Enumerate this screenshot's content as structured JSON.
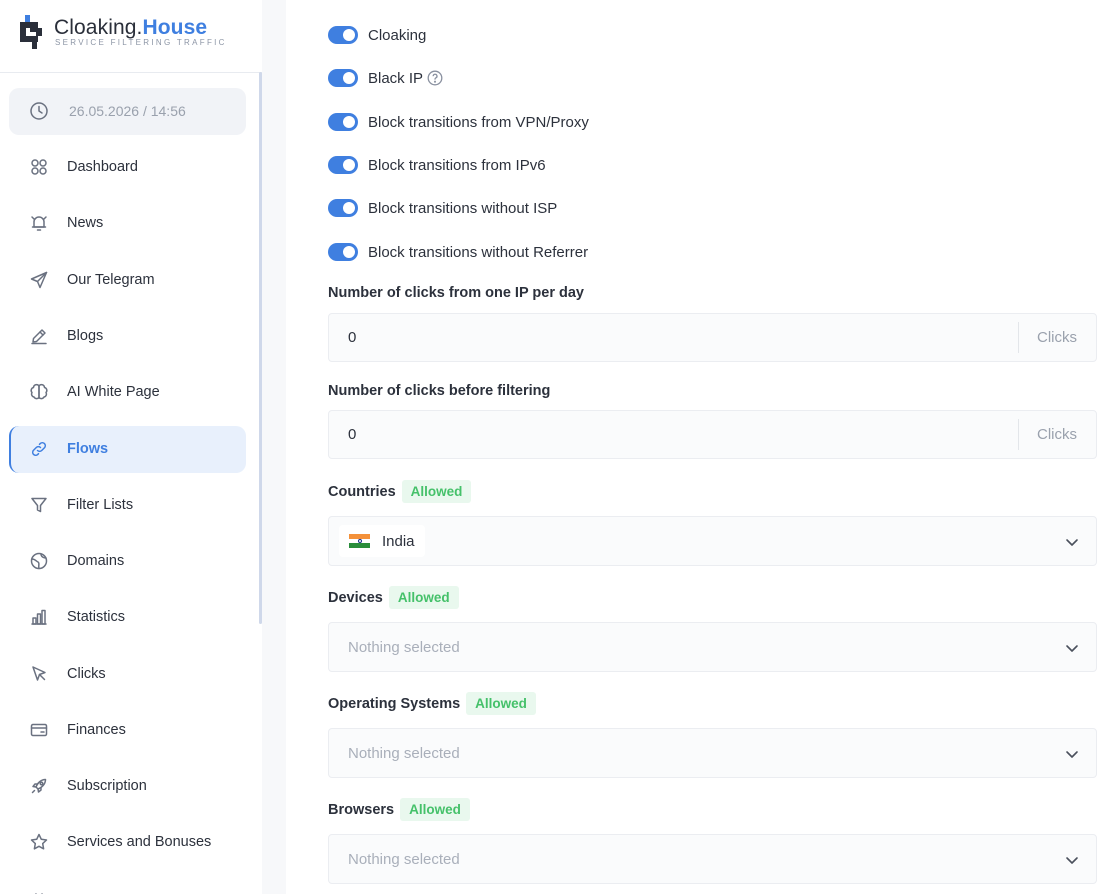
{
  "brand": {
    "name_part1": "Cloaking.",
    "name_part2": "House",
    "tagline": "SERVICE FILTERING TRAFFIC",
    "accent_color": "#3f7fe0"
  },
  "sidebar": {
    "datetime": "26.05.2026 / 14:56",
    "items": [
      {
        "label": "Dashboard",
        "icon": "dashboard-icon"
      },
      {
        "label": "News",
        "icon": "bell-icon"
      },
      {
        "label": "Our Telegram",
        "icon": "send-icon"
      },
      {
        "label": "Blogs",
        "icon": "pencil-icon"
      },
      {
        "label": "AI White Page",
        "icon": "brain-icon"
      },
      {
        "label": "Flows",
        "icon": "link-icon",
        "active": true
      },
      {
        "label": "Filter Lists",
        "icon": "filter-icon"
      },
      {
        "label": "Domains",
        "icon": "globe-icon"
      },
      {
        "label": "Statistics",
        "icon": "bar-chart-icon"
      },
      {
        "label": "Clicks",
        "icon": "cursor-icon"
      },
      {
        "label": "Finances",
        "icon": "wallet-icon"
      },
      {
        "label": "Subscription",
        "icon": "rocket-icon"
      },
      {
        "label": "Services and Bonuses",
        "icon": "star-icon"
      }
    ]
  },
  "toggles": [
    {
      "label": "Cloaking",
      "on": true
    },
    {
      "label": "Black IP",
      "on": true,
      "help": true
    },
    {
      "label": "Block transitions from VPN/Proxy",
      "on": true
    },
    {
      "label": "Block transitions from IPv6",
      "on": true
    },
    {
      "label": "Block transitions without ISP",
      "on": true
    },
    {
      "label": "Block transitions without Referrer",
      "on": true
    }
  ],
  "fields": {
    "clicks_per_ip": {
      "label": "Number of clicks from one IP per day",
      "value": "0",
      "suffix": "Clicks"
    },
    "clicks_before_filter": {
      "label": "Number of clicks before filtering",
      "value": "0",
      "suffix": "Clicks"
    }
  },
  "selects": {
    "countries": {
      "label": "Countries",
      "badge": "Allowed",
      "selected": "India"
    },
    "devices": {
      "label": "Devices",
      "badge": "Allowed",
      "placeholder": "Nothing selected"
    },
    "os": {
      "label": "Operating Systems",
      "badge": "Allowed",
      "placeholder": "Nothing selected"
    },
    "browsers": {
      "label": "Browsers",
      "badge": "Allowed",
      "placeholder": "Nothing selected"
    }
  }
}
